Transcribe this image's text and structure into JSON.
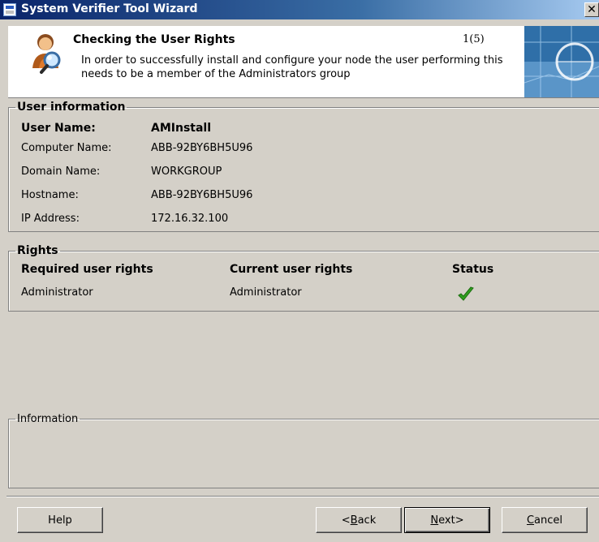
{
  "window": {
    "title": "System Verifier Tool Wizard",
    "close_glyph": "✕"
  },
  "header": {
    "title": "Checking the User Rights",
    "counter": "1(5)",
    "description": "In order to successfully install and configure your node the user performing this needs to be a member of the Administrators group"
  },
  "user_info": {
    "legend": "User information",
    "user_name_label": "User Name:",
    "user_name_value": "AMInstall",
    "computer_name_label": "Computer Name:",
    "computer_name_value": "ABB-92BY6BH5U96",
    "domain_name_label": "Domain Name:",
    "domain_name_value": "WORKGROUP",
    "hostname_label": "Hostname:",
    "hostname_value": "ABB-92BY6BH5U96",
    "ip_label": "IP Address:",
    "ip_value": "172.16.32.100"
  },
  "rights": {
    "legend": "Rights",
    "col_required": "Required user rights",
    "col_current": "Current user rights",
    "col_status": "Status",
    "rows": [
      {
        "required": "Administrator",
        "current": "Administrator",
        "status": "ok"
      }
    ]
  },
  "information": {
    "legend": "Information",
    "text": ""
  },
  "buttons": {
    "help": "Help",
    "back_prefix": "<",
    "back_accel": "B",
    "back_rest": "ack",
    "next_accel": "N",
    "next_rest": "ext>",
    "cancel_accel": "C",
    "cancel_rest": "ancel"
  },
  "colors": {
    "title_bar": "#0a246a",
    "dialog_face": "#d4d0c8",
    "check_green": "#2f9e1e"
  }
}
